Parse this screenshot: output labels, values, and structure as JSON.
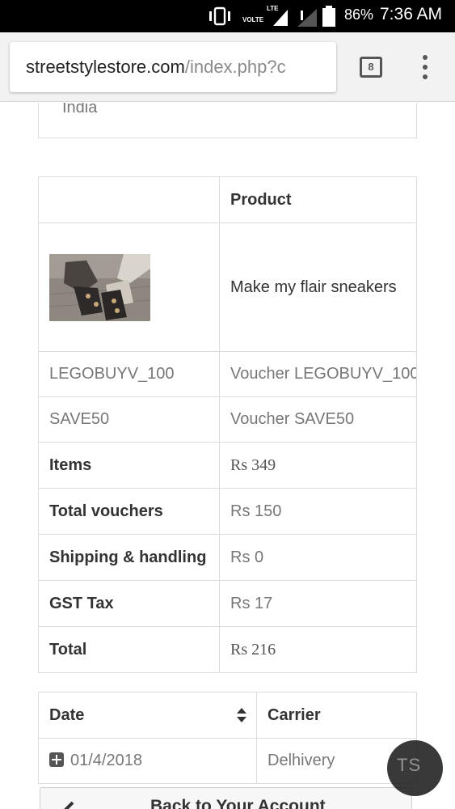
{
  "status_bar": {
    "network": "VOLTE",
    "lte": "LTE",
    "battery": "86%",
    "time": "7:36 AM"
  },
  "browser": {
    "url_host": "streetstylestore.com",
    "url_path": "/index.php?c",
    "tab_count": "8"
  },
  "address": {
    "country": "India"
  },
  "order_table": {
    "header_product": "Product",
    "product_name": "Make my flair sneakers",
    "vouchers": [
      {
        "code": "LEGOBUYV_100",
        "name": "Voucher LEGOBUYV_100"
      },
      {
        "code": "SAVE50",
        "name": "Voucher SAVE50"
      }
    ],
    "totals": [
      {
        "label": "Items",
        "value": "Rs 349"
      },
      {
        "label": "Total vouchers",
        "value": "Rs 150"
      },
      {
        "label": "Shipping & handling",
        "value": "Rs 0"
      },
      {
        "label": "GST Tax",
        "value": "Rs 17"
      },
      {
        "label": "Total",
        "value": "Rs 216"
      }
    ]
  },
  "shipping_table": {
    "header_date": "Date",
    "header_carrier": "Carrier",
    "rows": [
      {
        "date": "01/4/2018",
        "carrier": "Delhivery"
      }
    ]
  },
  "back_button": {
    "label": "Back to Your Account"
  },
  "watermark": {
    "text": "TS"
  }
}
